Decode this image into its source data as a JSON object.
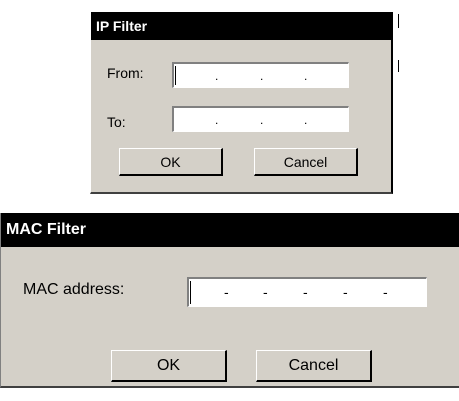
{
  "ip_filter": {
    "title": "IP Filter",
    "from_label": "From:",
    "to_label": "To:",
    "from_octets": [
      "",
      "",
      "",
      ""
    ],
    "to_octets": [
      "",
      "",
      "",
      ""
    ],
    "separator": ".",
    "ok_label": "OK",
    "cancel_label": "Cancel"
  },
  "mac_filter": {
    "title": "MAC Filter",
    "mac_label": "MAC address:",
    "mac_bytes": [
      "",
      "",
      "",
      "",
      "",
      ""
    ],
    "separator": "-",
    "ok_label": "OK",
    "cancel_label": "Cancel"
  }
}
